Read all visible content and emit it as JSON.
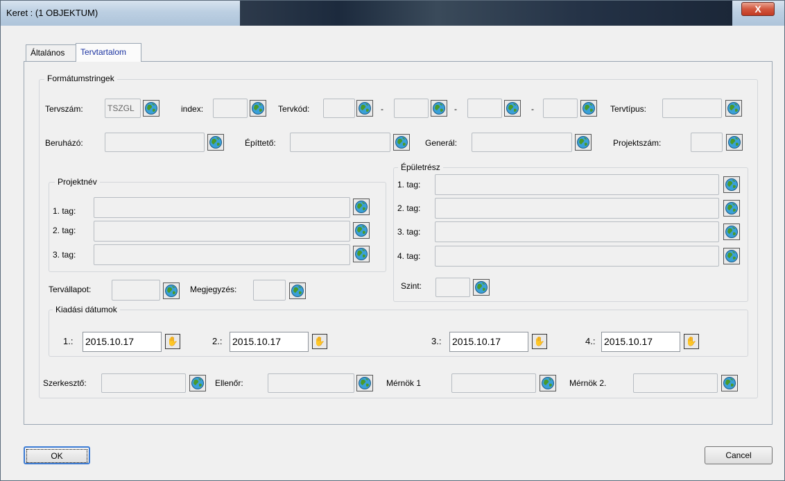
{
  "window": {
    "title": "Keret : (1 OBJEKTUM)",
    "close": "X"
  },
  "tabs": [
    "Általános",
    "Tervtartalom"
  ],
  "format": {
    "title": "Formátumstringek",
    "tervszam": {
      "label": "Tervszám:",
      "value": "TSZGL"
    },
    "index": "index:",
    "tervkod": "Tervkód:",
    "dash": "-",
    "tervtipus": "Tervtípus:",
    "beruhazo": "Beruházó:",
    "epitteto": "Építtető:",
    "generál": "Generál:",
    "projektszam": "Projektszám:"
  },
  "projektnev": {
    "title": "Projektnév",
    "tags": [
      "1. tag:",
      "2. tag:",
      "3. tag:"
    ]
  },
  "epuletresz": {
    "title": "Épületrész",
    "tags": [
      "1. tag:",
      "2. tag:",
      "3. tag:",
      "4. tag:"
    ],
    "szint": "Szint:"
  },
  "tervallapot": "Tervállapot:",
  "megjegyzes": "Megjegyzés:",
  "kiadasi": {
    "title": "Kiadási dátumok",
    "dates": [
      {
        "label": "1.:",
        "value": "2015.10.17"
      },
      {
        "label": "2.:",
        "value": "2015.10.17"
      },
      {
        "label": "3.:",
        "value": "2015.10.17"
      },
      {
        "label": "4.:",
        "value": "2015.10.17"
      }
    ]
  },
  "people": {
    "szerkeszto": "Szerkesztő:",
    "ellenor": "Ellenőr:",
    "mernok1": "Mérnök 1",
    "mernok2": "Mérnök 2."
  },
  "buttons": {
    "ok": "OK",
    "cancel": "Cancel"
  },
  "icons": {
    "globe": "globe-icon",
    "hand": "hand-icon"
  }
}
